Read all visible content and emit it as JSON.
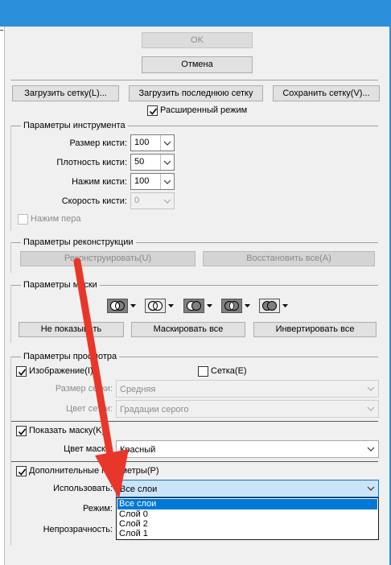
{
  "buttons": {
    "ok": "OK",
    "cancel": "Отмена",
    "load_mesh": "Загрузить сетку(L)...",
    "load_last_mesh": "Загрузить последнюю сетку",
    "save_mesh": "Сохранить сетку(V)..."
  },
  "advanced_mode": {
    "label": "Расширенный режим",
    "checked": true
  },
  "tool_options": {
    "title": "Параметры инструмента",
    "brush_size": {
      "label": "Размер кисти:",
      "value": "100"
    },
    "brush_density": {
      "label": "Плотность кисти:",
      "value": "50"
    },
    "brush_pressure": {
      "label": "Нажим кисти:",
      "value": "100"
    },
    "brush_rate": {
      "label": "Скорость кисти:",
      "value": "0"
    },
    "stylus_pressure": {
      "label": "Нажим пера",
      "checked": false
    }
  },
  "reconstruct_options": {
    "title": "Параметры реконструкции",
    "reconstruct_button": "Реконструировать(U)",
    "restore_all_button": "Восстановить все(A)"
  },
  "mask_options": {
    "title": "Параметры маски",
    "icons": [
      "mask-replace-icon",
      "mask-add-icon",
      "mask-subtract-icon",
      "mask-intersect-icon",
      "mask-invert-icon"
    ],
    "none_button": "Не показывать",
    "mask_all_button": "Маскировать все",
    "invert_all_button": "Инвертировать все"
  },
  "view_options": {
    "title": "Параметры просмотра",
    "show_image": {
      "label": "Изображение(I)",
      "checked": true
    },
    "show_mesh": {
      "label": "Сетка(E)",
      "checked": false
    },
    "mesh_size": {
      "label": "Размер сетки:",
      "value": "Средняя"
    },
    "mesh_color": {
      "label": "Цвет сетки:",
      "value": "Градации серого"
    },
    "show_mask": {
      "label": "Показать маску(K)",
      "checked": true
    },
    "mask_color": {
      "label": "Цвет маски:",
      "value": "Красный"
    },
    "show_backdrop": {
      "label": "Дополнительные параметры(P)",
      "checked": true
    },
    "use": {
      "label": "Использовать:",
      "value": "Все слои"
    },
    "mode": {
      "label": "Режим:"
    },
    "opacity": {
      "label": "Непрозрачность:"
    }
  },
  "dropdown": {
    "items": [
      "Все слои",
      "Слой 0",
      "Слой 2",
      "Слой 1"
    ],
    "selected_index": 0
  },
  "colors": {
    "titlebar": "#2b8fdc",
    "selection": "#0078d7",
    "annotation_arrow": "#e8372a"
  }
}
